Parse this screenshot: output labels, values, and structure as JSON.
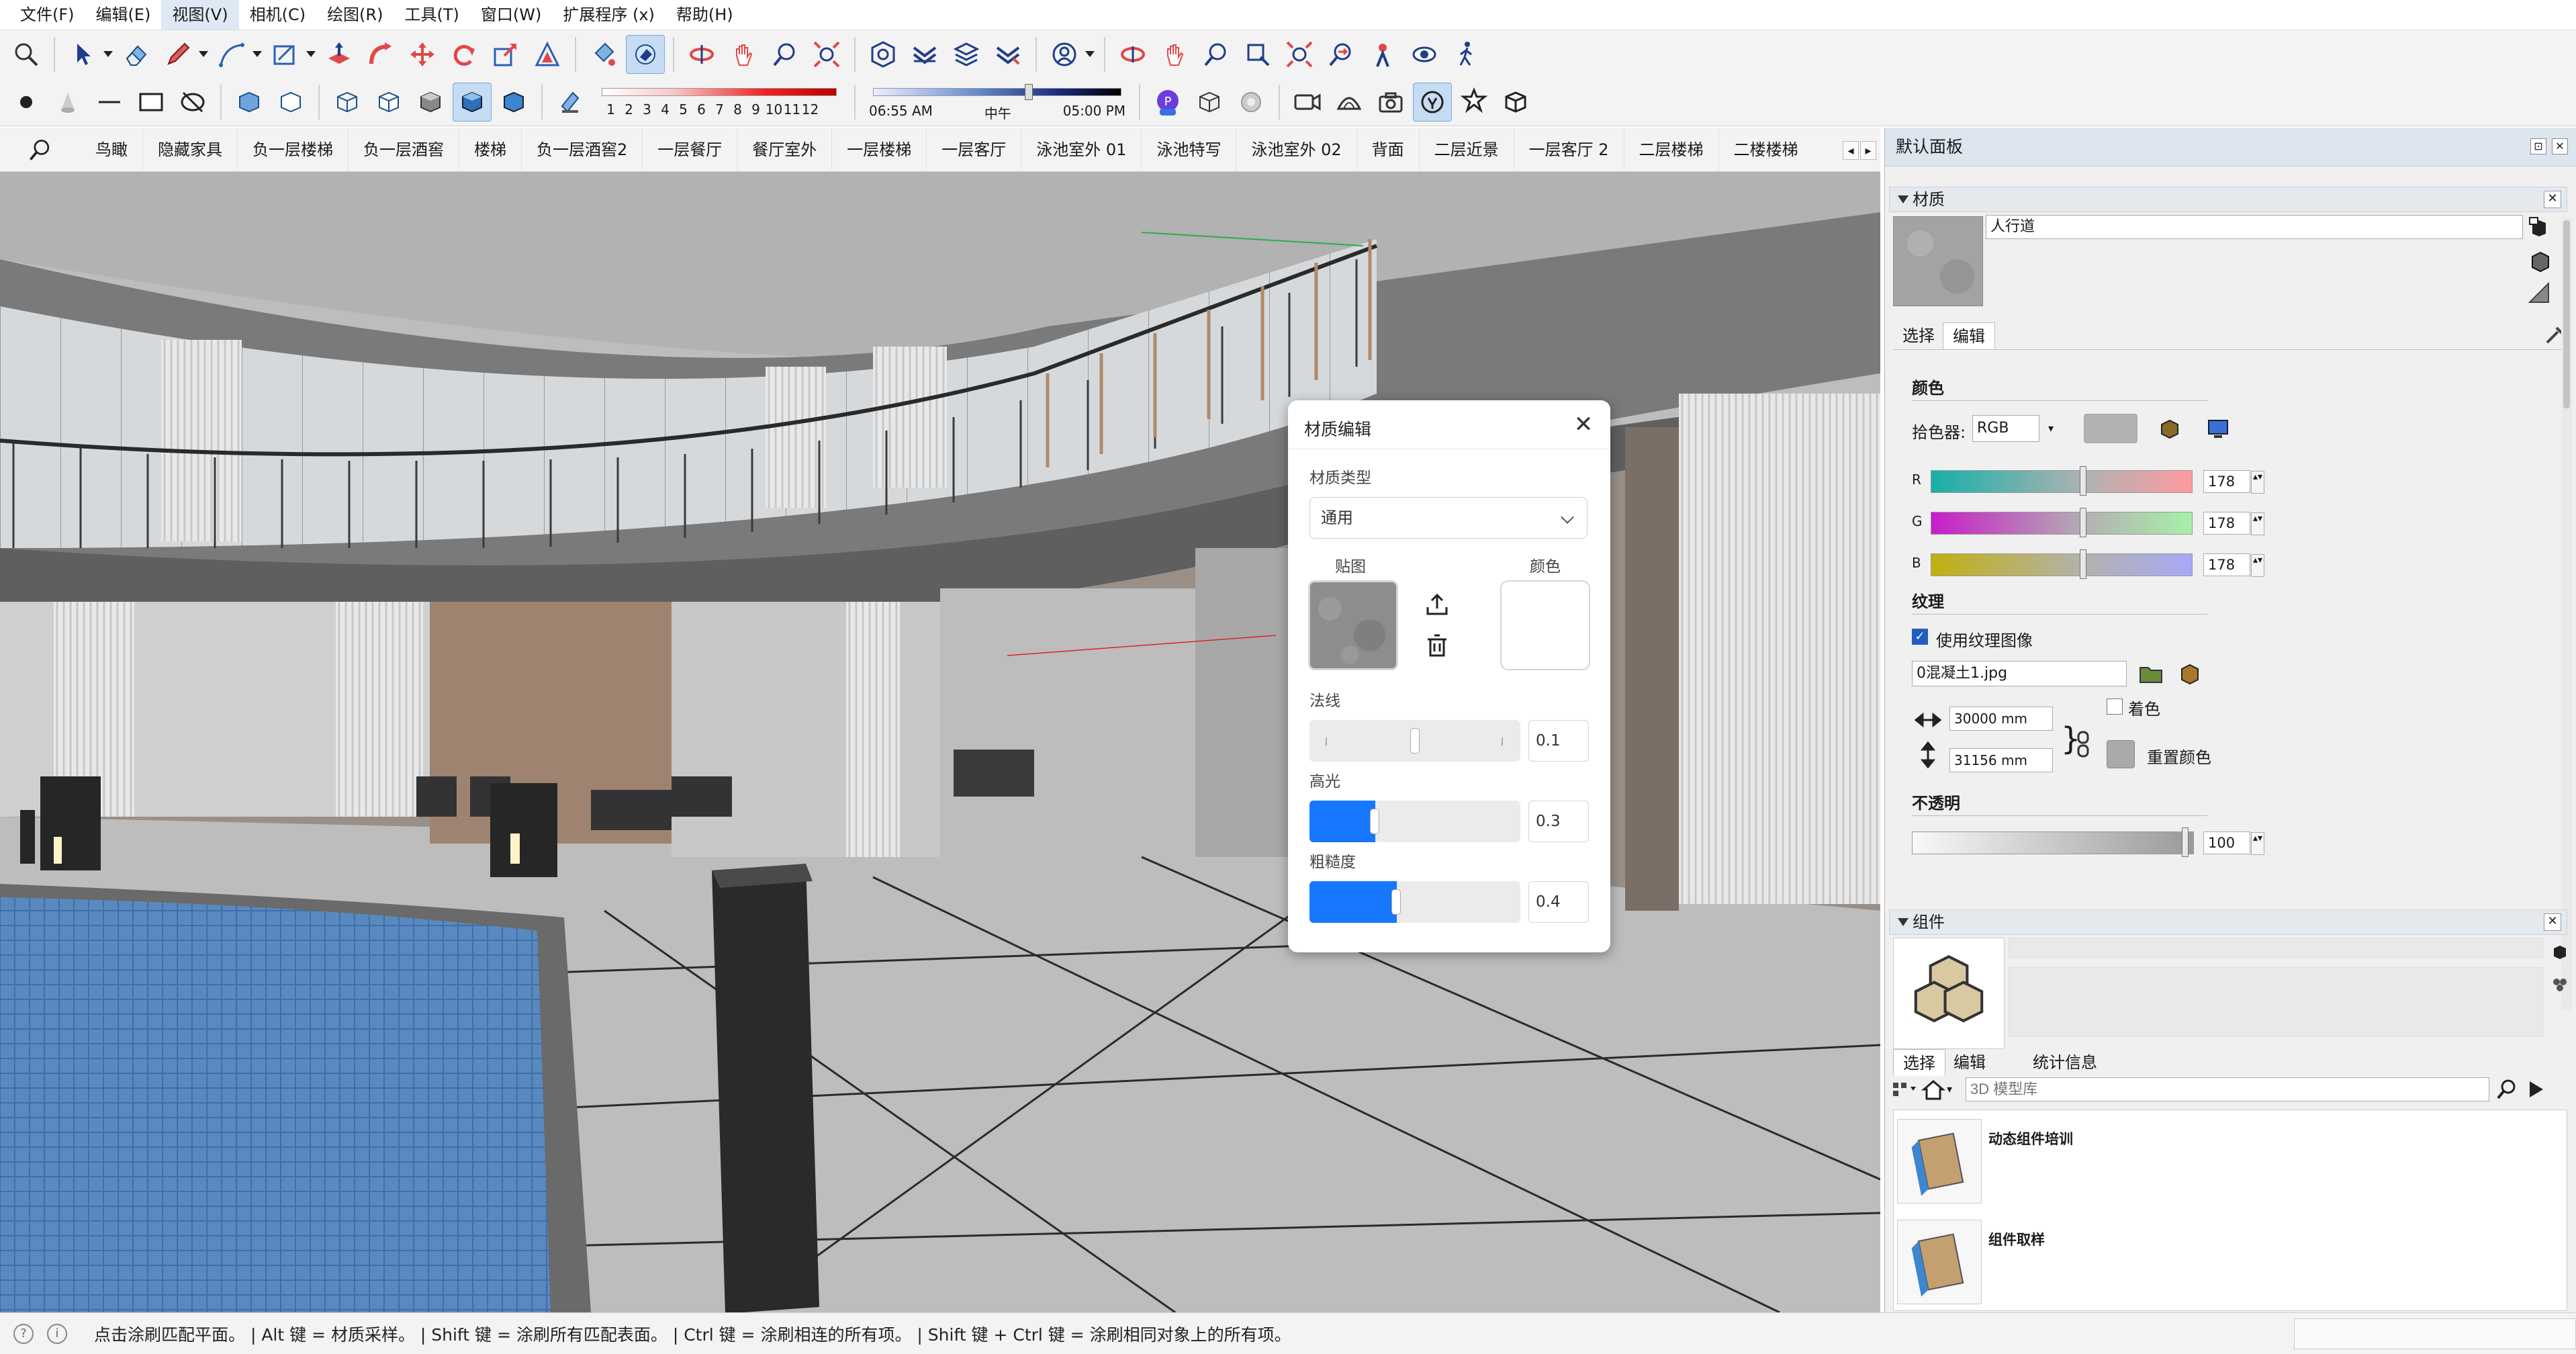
{
  "menu": [
    "文件(F)",
    "编辑(E)",
    "视图(V)",
    "相机(C)",
    "绘图(R)",
    "工具(T)",
    "窗口(W)",
    "扩展程序 (x)",
    "帮助(H)"
  ],
  "toolbar1": {
    "icons": [
      "search-icon",
      "select-arrow-icon",
      "eraser-icon",
      "pencil-icon",
      "line-icon",
      "shape-icon",
      "push-pull-icon",
      "follow-me-icon",
      "move-icon",
      "rotate-icon",
      "scale-icon",
      "offset-icon",
      "paint-bucket-icon",
      "paint-match-icon",
      "orbit-icon",
      "pan-icon",
      "zoom-icon",
      "zoom-extents-icon",
      "3d-warehouse-icon",
      "layers-icon",
      "stack-icon",
      "wave-icon",
      "profile-icon",
      "tape-measure-icon",
      "hand-icon",
      "zoom-window-icon",
      "zoom-fit-icon",
      "previous-view-icon",
      "position-camera-icon",
      "look-around-icon",
      "walk-icon"
    ]
  },
  "shadow": {
    "months": [
      "1",
      "2",
      "3",
      "4",
      "5",
      "6",
      "7",
      "8",
      "9",
      "10",
      "11",
      "12"
    ]
  },
  "time": {
    "start": "06:55 AM",
    "mid": "中午",
    "end": "05:00 PM"
  },
  "scenes": {
    "tabs": [
      "鸟瞰",
      "隐藏家具",
      "负一层楼梯",
      "负一层酒窖",
      "楼梯",
      "负一层酒窖2",
      "一层餐厅",
      "餐厅室外",
      "一层楼梯",
      "一层客厅",
      "泳池室外 01",
      "泳池特写",
      "泳池室外 02",
      "背面",
      "二层近景",
      "一层客厅 2",
      "二层楼梯",
      "二楼楼梯"
    ]
  },
  "dialog": {
    "title": "材质编辑",
    "type_label": "材质类型",
    "type_value": "通用",
    "texture_label": "贴图",
    "color_label": "颜色",
    "normal_label": "法线",
    "normal_value": "0.1",
    "specular_label": "高光",
    "specular_value": "0.3",
    "roughness_label": "粗糙度",
    "roughness_value": "0.4",
    "levels": {
      "normal": 0.1,
      "specular": 0.3,
      "roughness": 0.4
    }
  },
  "panel": {
    "title": "默认面板",
    "materials": {
      "header": "材质",
      "name": "人行道",
      "tab_select": "选择",
      "tab_edit": "编辑",
      "color_heading": "颜色",
      "picker_label": "拾色器:",
      "picker_mode": "RGB",
      "r_label": "R",
      "r_value": "178",
      "g_label": "G",
      "g_value": "178",
      "b_label": "B",
      "b_value": "178",
      "texture_heading": "纹理",
      "use_texture": "使用纹理图像",
      "texture_file": "0混凝土1.jpg",
      "width": "30000 mm",
      "height": "31156 mm",
      "colorize": "着色",
      "reset_color": "重置颜色",
      "opacity_heading": "不透明",
      "opacity_value": "100",
      "swatch_color": "#b2b2b2"
    },
    "components": {
      "header": "组件",
      "tab_select": "选择",
      "tab_edit": "编辑",
      "tab_stats": "统计信息",
      "search_placeholder": "3D 模型库",
      "items": [
        "动态组件培训",
        "组件取样"
      ]
    }
  },
  "status": {
    "text": "点击涂刷匹配平面。 | Alt 键 = 材质采样。 | Shift 键 = 涂刷所有匹配表面。 | Ctrl 键 = 涂刷相连的所有项。 | Shift 键 + Ctrl 键 = 涂刷相同对象上的所有项。"
  }
}
